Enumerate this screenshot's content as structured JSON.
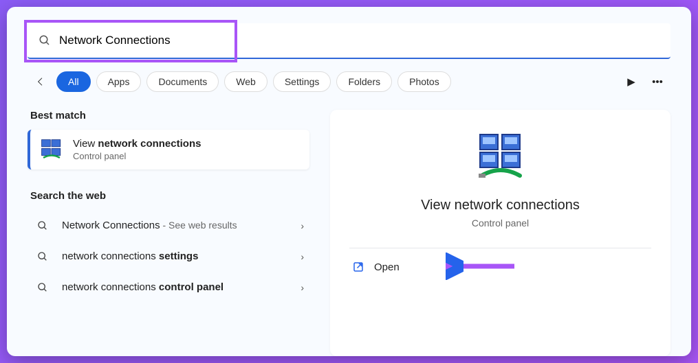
{
  "search": {
    "value": "Network Connections"
  },
  "filters": {
    "items": [
      "All",
      "Apps",
      "Documents",
      "Web",
      "Settings",
      "Folders",
      "Photos"
    ],
    "active": 0
  },
  "left": {
    "best_match_header": "Best match",
    "best_result": {
      "title_prefix": "View ",
      "title_bold": "network connections",
      "subtitle": "Control panel"
    },
    "web_header": "Search the web",
    "web_items": [
      {
        "text": "Network Connections",
        "suffix": " - See web results"
      },
      {
        "text_prefix": "network connections ",
        "text_bold": "settings"
      },
      {
        "text_prefix": "network connections ",
        "text_bold": "control panel"
      }
    ]
  },
  "right": {
    "title": "View network connections",
    "subtitle": "Control panel",
    "open_label": "Open"
  }
}
